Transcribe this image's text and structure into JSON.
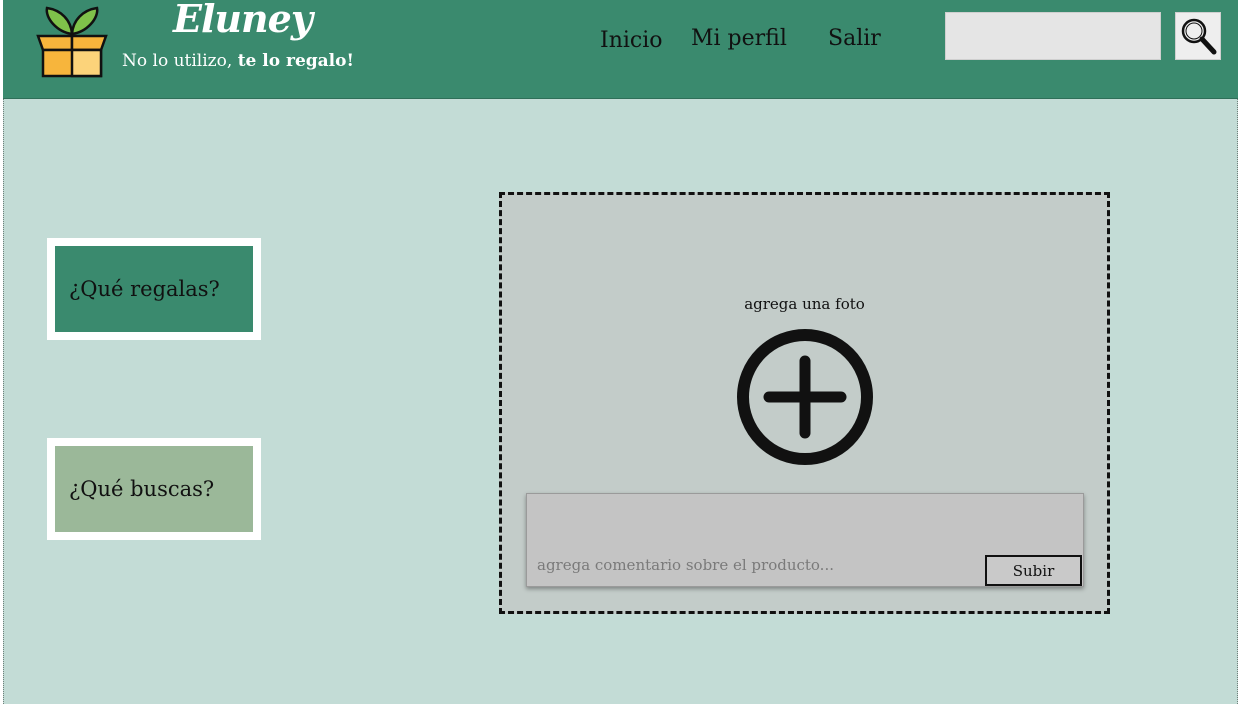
{
  "header": {
    "brand": "Eluney",
    "tagline_plain": "No lo utilizo, ",
    "tagline_bold": "te lo regalo!",
    "nav": [
      {
        "label": "Inicio"
      },
      {
        "label": "Mi perfil"
      },
      {
        "label": "Salir"
      }
    ],
    "search": {
      "value": "",
      "placeholder": ""
    },
    "logo_icon": "gift-box-with-sprout-icon",
    "search_icon": "magnifier-icon"
  },
  "sidebar": {
    "regalas_label": "¿Qué regalas?",
    "buscas_label": "¿Qué buscas?"
  },
  "upload": {
    "photo_label": "agrega una foto",
    "add_icon": "plus-circle-icon",
    "comment_placeholder": "agrega comentario sobre el producto...",
    "submit_label": "Subir"
  },
  "colors": {
    "header": "#3a8a6e",
    "page_background": "#c3dcd6",
    "card_regalas": "#3a8a6e",
    "card_buscas": "#9bb899",
    "upload_background": "#c3ccc9",
    "comment_background": "#c4c4c4"
  }
}
